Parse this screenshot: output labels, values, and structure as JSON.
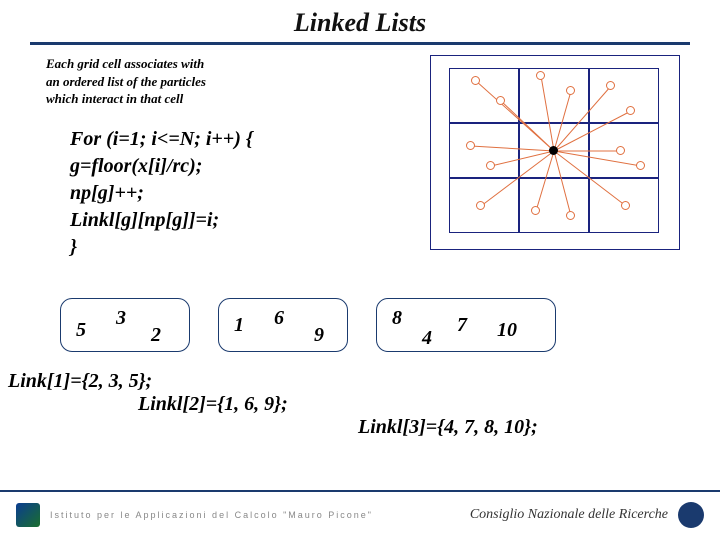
{
  "title": "Linked Lists",
  "desc": {
    "l1": "Each grid cell associates with",
    "l2": "an ordered list of the particles",
    "l3": "which interact in that cell"
  },
  "code": {
    "l1": "For (i=1; i<=N; i++)  {",
    "l2": "  g=floor(x[i]/rc);",
    "l3": "  np[g]++;",
    "l4": "  Linkl[g][np[g]]=i;",
    "l5": "}"
  },
  "buckets": {
    "b1": {
      "a": "5",
      "b": "3",
      "c": "2"
    },
    "b2": {
      "a": "1",
      "b": "6",
      "c": "9"
    },
    "b3": {
      "a": "8",
      "b": "4",
      "c": "7",
      "d": "10"
    }
  },
  "links": {
    "l1": "Link[1]={2, 3, 5};",
    "l2": "Linkl[2]={1, 6, 9};",
    "l3": "Linkl[3]={4, 7, 8, 10};"
  },
  "footer": {
    "left": "Istituto per le Applicazioni del Calcolo \"Mauro Picone\"",
    "right": "Consiglio Nazionale delle Ricerche"
  }
}
